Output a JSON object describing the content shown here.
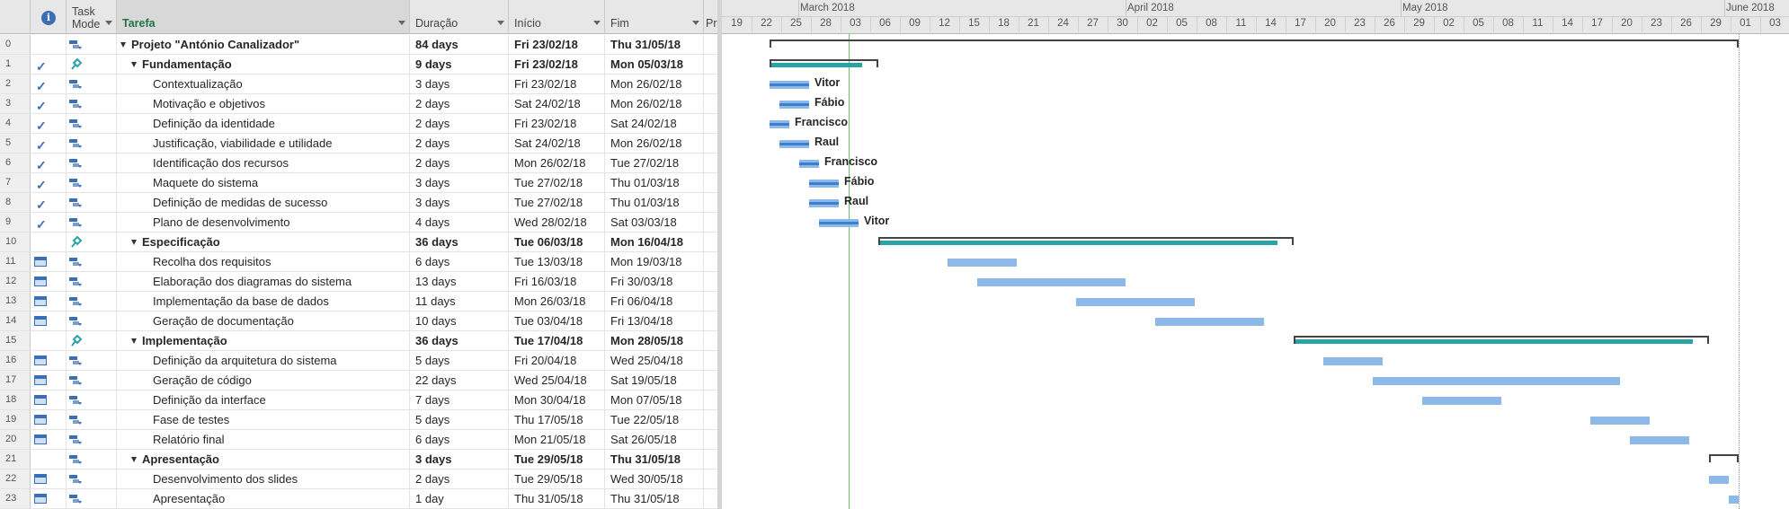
{
  "columns": {
    "id": "",
    "indicator_icon": "info-icon",
    "task_mode": "Task Mode",
    "name": "Tarefa",
    "duration": "Duração",
    "start": "Início",
    "finish": "Fim",
    "predecessors": "Pr"
  },
  "timescale": {
    "months": [
      "March 2018",
      "April 2018",
      "May 2018",
      "June 2018"
    ],
    "days": [
      "19",
      "22",
      "25",
      "28",
      "03",
      "06",
      "09",
      "12",
      "15",
      "18",
      "21",
      "24",
      "27",
      "30",
      "02",
      "05",
      "08",
      "11",
      "14",
      "17",
      "20",
      "23",
      "26",
      "29",
      "02",
      "05",
      "08",
      "11",
      "14",
      "17",
      "20",
      "23",
      "26",
      "29",
      "01",
      "03"
    ]
  },
  "tasks": [
    {
      "id": "0",
      "indicator": "",
      "mode": "auto",
      "name": "Projeto \"António Canalizador\"",
      "level": 0,
      "summary": true,
      "duration": "84 days",
      "start": "Fri 23/02/18",
      "finish": "Thu 31/05/18"
    },
    {
      "id": "1",
      "indicator": "check",
      "mode": "manual",
      "name": "Fundamentação",
      "level": 1,
      "summary": true,
      "duration": "9 days",
      "start": "Fri 23/02/18",
      "finish": "Mon 05/03/18"
    },
    {
      "id": "2",
      "indicator": "check",
      "mode": "auto",
      "name": "Contextualização",
      "level": 2,
      "summary": false,
      "duration": "3 days",
      "start": "Fri 23/02/18",
      "finish": "Mon 26/02/18",
      "resource": "Vitor"
    },
    {
      "id": "3",
      "indicator": "check",
      "mode": "auto",
      "name": "Motivação e objetivos",
      "level": 2,
      "summary": false,
      "duration": "2 days",
      "start": "Sat 24/02/18",
      "finish": "Mon 26/02/18",
      "resource": "Fábio"
    },
    {
      "id": "4",
      "indicator": "check",
      "mode": "auto",
      "name": "Definição da identidade",
      "level": 2,
      "summary": false,
      "duration": "2 days",
      "start": "Fri 23/02/18",
      "finish": "Sat 24/02/18",
      "resource": "Francisco"
    },
    {
      "id": "5",
      "indicator": "check",
      "mode": "auto",
      "name": "Justificação, viabilidade e utilidade",
      "level": 2,
      "summary": false,
      "duration": "2 days",
      "start": "Sat 24/02/18",
      "finish": "Mon 26/02/18",
      "resource": "Raul"
    },
    {
      "id": "6",
      "indicator": "check",
      "mode": "auto",
      "name": "Identificação dos recursos",
      "level": 2,
      "summary": false,
      "duration": "2 days",
      "start": "Mon 26/02/18",
      "finish": "Tue 27/02/18",
      "resource": "Francisco"
    },
    {
      "id": "7",
      "indicator": "check",
      "mode": "auto",
      "name": "Maquete do sistema",
      "level": 2,
      "summary": false,
      "duration": "3 days",
      "start": "Tue 27/02/18",
      "finish": "Thu 01/03/18",
      "resource": "Fábio"
    },
    {
      "id": "8",
      "indicator": "check",
      "mode": "auto",
      "name": "Definição de medidas de sucesso",
      "level": 2,
      "summary": false,
      "duration": "3 days",
      "start": "Tue 27/02/18",
      "finish": "Thu 01/03/18",
      "resource": "Raul"
    },
    {
      "id": "9",
      "indicator": "check",
      "mode": "auto",
      "name": "Plano de desenvolvimento",
      "level": 2,
      "summary": false,
      "duration": "4 days",
      "start": "Wed 28/02/18",
      "finish": "Sat 03/03/18",
      "resource": "Vitor"
    },
    {
      "id": "10",
      "indicator": "",
      "mode": "manual",
      "name": "Especificação",
      "level": 1,
      "summary": true,
      "duration": "36 days",
      "start": "Tue 06/03/18",
      "finish": "Mon 16/04/18"
    },
    {
      "id": "11",
      "indicator": "calendar",
      "mode": "auto",
      "name": "Recolha dos requisitos",
      "level": 2,
      "summary": false,
      "duration": "6 days",
      "start": "Tue 13/03/18",
      "finish": "Mon 19/03/18"
    },
    {
      "id": "12",
      "indicator": "calendar",
      "mode": "auto",
      "name": "Elaboração dos diagramas do sistema",
      "level": 2,
      "summary": false,
      "duration": "13 days",
      "start": "Fri 16/03/18",
      "finish": "Fri 30/03/18"
    },
    {
      "id": "13",
      "indicator": "calendar",
      "mode": "auto",
      "name": "Implementação da base de dados",
      "level": 2,
      "summary": false,
      "duration": "11 days",
      "start": "Mon 26/03/18",
      "finish": "Fri 06/04/18"
    },
    {
      "id": "14",
      "indicator": "calendar",
      "mode": "auto",
      "name": "Geração de documentação",
      "level": 2,
      "summary": false,
      "duration": "10 days",
      "start": "Tue 03/04/18",
      "finish": "Fri 13/04/18"
    },
    {
      "id": "15",
      "indicator": "",
      "mode": "manual",
      "name": "Implementação",
      "level": 1,
      "summary": true,
      "duration": "36 days",
      "start": "Tue 17/04/18",
      "finish": "Mon 28/05/18"
    },
    {
      "id": "16",
      "indicator": "calendar",
      "mode": "auto",
      "name": "Definição da arquitetura do sistema",
      "level": 2,
      "summary": false,
      "duration": "5 days",
      "start": "Fri 20/04/18",
      "finish": "Wed 25/04/18"
    },
    {
      "id": "17",
      "indicator": "calendar",
      "mode": "auto",
      "name": "Geração de código",
      "level": 2,
      "summary": false,
      "duration": "22 days",
      "start": "Wed 25/04/18",
      "finish": "Sat 19/05/18"
    },
    {
      "id": "18",
      "indicator": "calendar",
      "mode": "auto",
      "name": "Definição da interface",
      "level": 2,
      "summary": false,
      "duration": "7 days",
      "start": "Mon 30/04/18",
      "finish": "Mon 07/05/18"
    },
    {
      "id": "19",
      "indicator": "calendar",
      "mode": "auto",
      "name": "Fase de testes",
      "level": 2,
      "summary": false,
      "duration": "5 days",
      "start": "Thu 17/05/18",
      "finish": "Tue 22/05/18"
    },
    {
      "id": "20",
      "indicator": "calendar",
      "mode": "auto",
      "name": "Relatório final",
      "level": 2,
      "summary": false,
      "duration": "6 days",
      "start": "Mon 21/05/18",
      "finish": "Sat 26/05/18"
    },
    {
      "id": "21",
      "indicator": "",
      "mode": "auto",
      "name": "Apresentação",
      "level": 1,
      "summary": true,
      "duration": "3 days",
      "start": "Tue 29/05/18",
      "finish": "Thu 31/05/18"
    },
    {
      "id": "22",
      "indicator": "calendar",
      "mode": "auto",
      "name": "Desenvolvimento dos slides",
      "level": 2,
      "summary": false,
      "duration": "2 days",
      "start": "Tue 29/05/18",
      "finish": "Wed 30/05/18"
    },
    {
      "id": "23",
      "indicator": "calendar",
      "mode": "auto",
      "name": "Apresentação",
      "level": 2,
      "summary": false,
      "duration": "1 day",
      "start": "Thu 31/05/18",
      "finish": "Thu 31/05/18"
    }
  ],
  "colors": {
    "bar": "#8db9e9",
    "bar_progress": "#3c7fd1",
    "summary_progress": "#2aa3a6",
    "summary_bracket": "#444444",
    "today_line": "#6cc26c",
    "check": "#3a6fb7"
  }
}
